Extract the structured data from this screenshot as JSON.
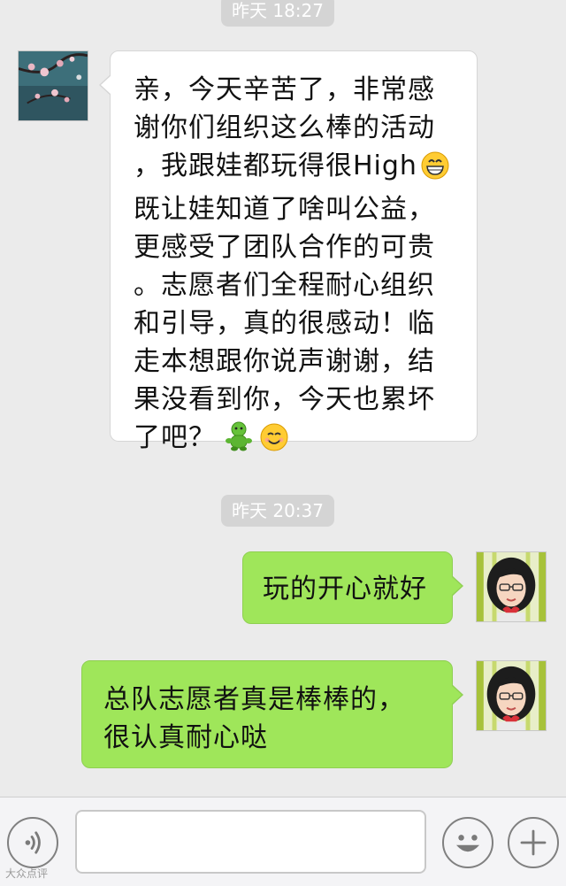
{
  "chat": {
    "timestamps": [
      "昨天 18:27",
      "昨天 20:37"
    ],
    "messages": [
      {
        "sender": "contact",
        "lines": [
          "亲，今天辛苦了，非常感",
          "谢你们组织这么棒的活动",
          "，我跟娃都玩得很High",
          "既让娃知道了啥叫公益，",
          "更感受了团队合作的可贵",
          "。志愿者们全程耐心组织",
          "和引导，真的很感动！临",
          "走本想跟你说声谢谢，结",
          "果没看到你，今天也累坏",
          "了吧？"
        ],
        "emojis": [
          "grin-emoji",
          "green-figure-emoji",
          "smile-emoji"
        ]
      },
      {
        "sender": "me",
        "lines": [
          "玩的开心就好"
        ]
      },
      {
        "sender": "me",
        "lines": [
          "总队志愿者真是棒棒的，",
          "很认真耐心哒"
        ]
      }
    ]
  },
  "input_bar": {
    "text_value": "",
    "icons": [
      "voice-icon",
      "emoji-icon",
      "plus-icon"
    ]
  },
  "watermark": "大众点评",
  "colors": {
    "background": "#ebebeb",
    "incoming_bubble": "#ffffff",
    "outgoing_bubble": "#9fe65a",
    "timestamp_pill": "#d4d4d4"
  }
}
